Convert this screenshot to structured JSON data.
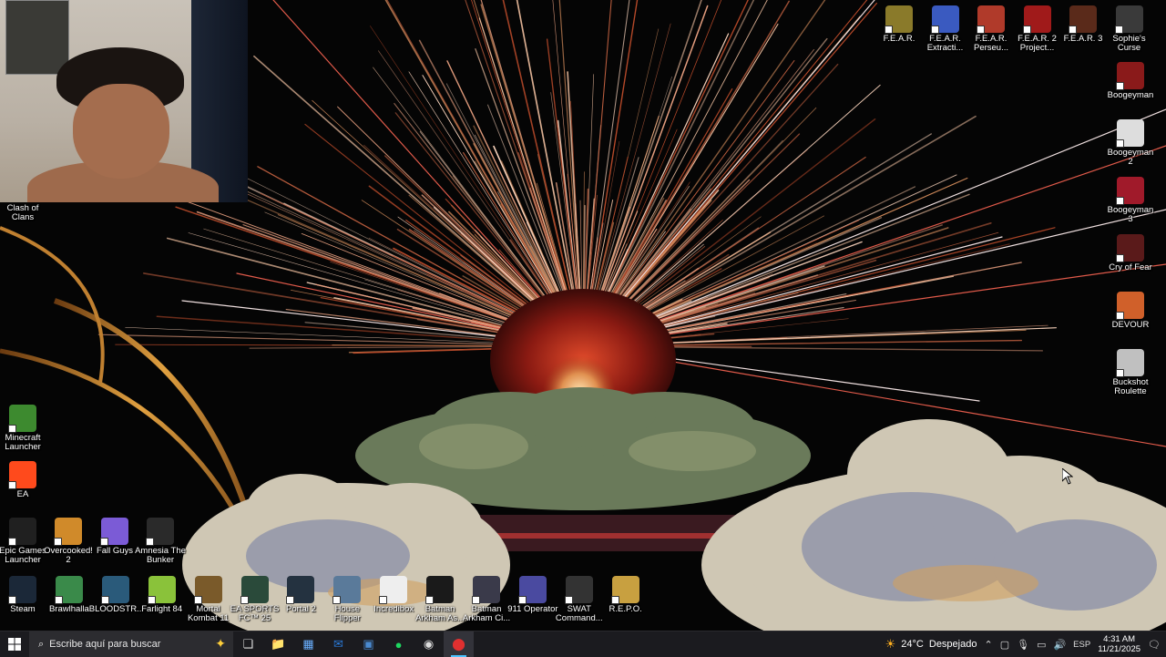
{
  "desktop": {
    "left_icons": [
      {
        "label": "Clash of Clans",
        "icon": "clash-of-clans-icon",
        "color": "#6a5a3a"
      },
      {
        "label": "Minecraft Launcher",
        "icon": "minecraft-icon",
        "color": "#3d8a2f"
      },
      {
        "label": "EA",
        "icon": "ea-icon",
        "color": "#ff4a1c"
      },
      {
        "label": "Epic Games Launcher",
        "icon": "epic-games-icon",
        "color": "#202020"
      },
      {
        "label": "Overcooked! 2",
        "icon": "overcooked-icon",
        "color": "#d08a2a"
      },
      {
        "label": "Fall Guys",
        "icon": "fall-guys-icon",
        "color": "#7b5bd6"
      },
      {
        "label": "Amnesia The Bunker",
        "icon": "amnesia-icon",
        "color": "#2a2a2a"
      }
    ],
    "bottom_icons": [
      {
        "label": "Steam",
        "icon": "steam-icon",
        "color": "#1b2838"
      },
      {
        "label": "Brawlhalla",
        "icon": "brawlhalla-icon",
        "color": "#3a8a4a"
      },
      {
        "label": "BLOODSTR...",
        "icon": "bloodstrike-icon",
        "color": "#2a5a7a"
      },
      {
        "label": "Farlight 84",
        "icon": "farlight-icon",
        "color": "#8ac23a"
      },
      {
        "label": "Mortal Kombat 11",
        "icon": "mortal-kombat-icon",
        "color": "#7a5a2a"
      },
      {
        "label": "EA SPORTS FC™ 25",
        "icon": "ea-fc-icon",
        "color": "#2a4a3a"
      },
      {
        "label": "Portal 2",
        "icon": "portal-icon",
        "color": "#243240"
      },
      {
        "label": "House Flipper",
        "icon": "house-flipper-icon",
        "color": "#5a7a9a"
      },
      {
        "label": "Incredibox",
        "icon": "incredibox-icon",
        "color": "#eeeeee"
      },
      {
        "label": "Batman Arkham As...",
        "icon": "batman-asylum-icon",
        "color": "#1a1a1a"
      },
      {
        "label": "Batman Arkham Ci...",
        "icon": "batman-city-icon",
        "color": "#3a3a4a"
      },
      {
        "label": "911 Operator",
        "icon": "911-operator-icon",
        "color": "#4a4aa0"
      },
      {
        "label": "SWAT Command...",
        "icon": "swat-icon",
        "color": "#333333"
      },
      {
        "label": "R.E.P.O.",
        "icon": "repo-icon",
        "color": "#c8a040"
      }
    ],
    "top_right_icons": [
      {
        "label": "F.E.A.R.",
        "icon": "fear-icon",
        "color": "#8a7a2a"
      },
      {
        "label": "F.E.A.R. Extracti...",
        "icon": "fear-extraction-icon",
        "color": "#3a5ac0"
      },
      {
        "label": "F.E.A.R. Perseu...",
        "icon": "fear-perseus-icon",
        "color": "#b03a2a"
      },
      {
        "label": "F.E.A.R. 2 Project...",
        "icon": "fear2-icon",
        "color": "#a01a1a"
      },
      {
        "label": "F.E.A.R. 3",
        "icon": "fear3-icon",
        "color": "#5a2a1a"
      },
      {
        "label": "Sophie's Curse",
        "icon": "sophies-curse-icon",
        "color": "#3a3a3a"
      }
    ],
    "right_icons": [
      {
        "label": "Boogeyman",
        "icon": "boogeyman-icon",
        "color": "#8a1a1a"
      },
      {
        "label": "Boogeyman 2",
        "icon": "boogeyman-2-icon",
        "color": "#dddddd"
      },
      {
        "label": "Boogeyman 3",
        "icon": "boogeyman-3-icon",
        "color": "#a01a2a"
      },
      {
        "label": "Cry of Fear",
        "icon": "cry-of-fear-icon",
        "color": "#5a1a1a"
      },
      {
        "label": "DEVOUR",
        "icon": "devour-icon",
        "color": "#d0602a"
      },
      {
        "label": "Buckshot Roulette",
        "icon": "buckshot-roulette-icon",
        "color": "#c0c0c0"
      }
    ]
  },
  "taskbar": {
    "search_placeholder": "Escribe aquí para buscar",
    "apps": [
      {
        "name": "task-view-icon",
        "glyph": "❏",
        "active": false
      },
      {
        "name": "file-explorer-icon",
        "glyph": "📁",
        "active": false
      },
      {
        "name": "microsoft-store-icon",
        "glyph": "▦",
        "active": false
      },
      {
        "name": "outlook-icon",
        "glyph": "✉",
        "active": false
      },
      {
        "name": "app-icon",
        "glyph": "▣",
        "active": false
      },
      {
        "name": "spotify-icon",
        "glyph": "●",
        "active": false
      },
      {
        "name": "obs-icon",
        "glyph": "◉",
        "active": false
      },
      {
        "name": "recording-app-icon",
        "glyph": "⬤",
        "active": true
      }
    ],
    "weather_temp": "24°C",
    "weather_desc": "Despejado",
    "language": "ESP",
    "time": "4:31 AM",
    "date": "11/21/2025"
  }
}
